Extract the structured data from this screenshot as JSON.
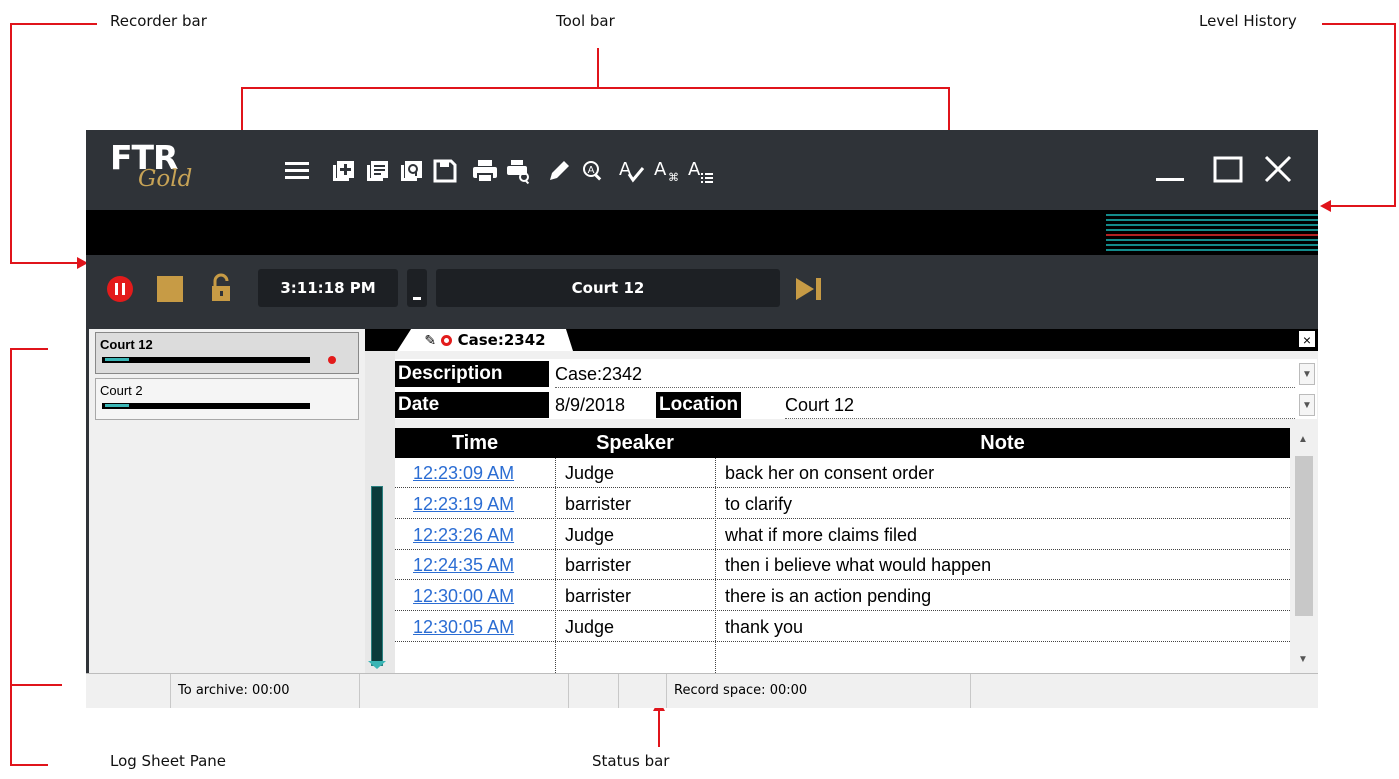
{
  "annotations": {
    "recorder_bar": "Recorder bar",
    "tool_bar": "Tool bar",
    "level_history": "Level History",
    "log_sheet_pane": "Log Sheet Pane",
    "status_bar": "Status bar"
  },
  "app": {
    "logo_main": "FTR",
    "logo_sub": "Gold",
    "toolbar_icons": [
      "menu-icon",
      "new-icon",
      "notes-icon",
      "search-doc-icon",
      "save-icon",
      "print-icon",
      "print-preview-icon",
      "edit-icon",
      "search-icon",
      "spellcheck-icon",
      "text-shortcut-icon",
      "text-list-icon"
    ]
  },
  "recorder": {
    "time": "3:11:18 PM",
    "court": "Court 12"
  },
  "rooms": [
    {
      "name": "Court 12",
      "level": 0.12
    },
    {
      "name": "Court 2",
      "level": 0.12
    }
  ],
  "logsheet": {
    "tab_label": "Case:2342",
    "close_label": "×",
    "description_label": "Description",
    "description_value": "Case:2342",
    "date_label": "Date",
    "date_value": "8/9/2018",
    "location_label": "Location",
    "location_value": "Court 12",
    "columns": [
      "Time",
      "Speaker",
      "Note"
    ],
    "rows": [
      {
        "time": "12:23:09 AM",
        "speaker": "Judge",
        "note": "back her on consent order"
      },
      {
        "time": "12:23:19 AM",
        "speaker": "barrister",
        "note": "to clarify"
      },
      {
        "time": "12:23:26 AM",
        "speaker": "Judge",
        "note": "what if more claims filed"
      },
      {
        "time": "12:24:35 AM",
        "speaker": "barrister",
        "note": "then i believe what would happen"
      },
      {
        "time": "12:30:00 AM",
        "speaker": "barrister",
        "note": "there is an action pending"
      },
      {
        "time": "12:30:05 AM",
        "speaker": "Judge",
        "note": "thank you"
      }
    ]
  },
  "status": {
    "archive": "To archive: 00:00",
    "record_space": "Record space: 00:00"
  },
  "colors": {
    "accent_red": "#e0141b",
    "gold": "#c79b45",
    "teal": "#3ab5b5",
    "link": "#2b6dd3"
  }
}
